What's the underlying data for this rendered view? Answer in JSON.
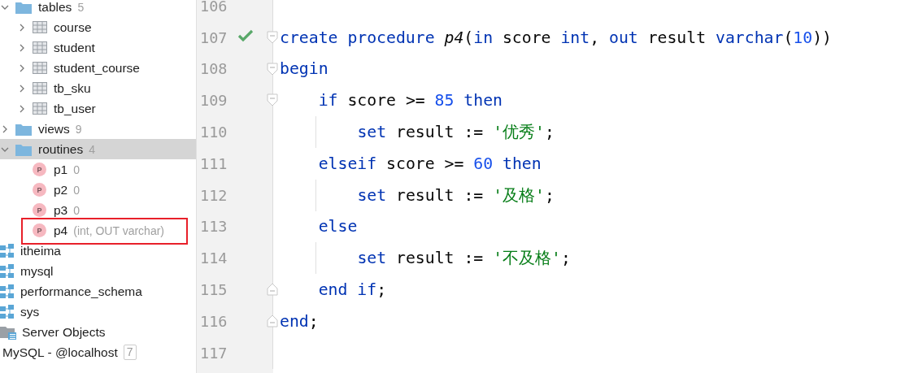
{
  "tree": {
    "objects": [
      {
        "label": "tables",
        "count": "5",
        "kind": "folder",
        "expanded": true,
        "selected": false,
        "children": [
          {
            "label": "course",
            "kind": "table",
            "expanded": false
          },
          {
            "label": "student",
            "kind": "table",
            "expanded": false
          },
          {
            "label": "student_course",
            "kind": "table",
            "expanded": false
          },
          {
            "label": "tb_sku",
            "kind": "table",
            "expanded": false
          },
          {
            "label": "tb_user",
            "kind": "table",
            "expanded": false
          }
        ]
      },
      {
        "label": "views",
        "count": "9",
        "kind": "folder",
        "expanded": false,
        "selected": false
      },
      {
        "label": "routines",
        "count": "4",
        "kind": "folder",
        "expanded": true,
        "selected": true,
        "children": [
          {
            "label": "p1",
            "detail": "0",
            "kind": "procedure",
            "badge": "P",
            "marked": false
          },
          {
            "label": "p2",
            "detail": "0",
            "kind": "procedure",
            "badge": "P",
            "marked": false
          },
          {
            "label": "p3",
            "detail": "0",
            "kind": "procedure",
            "badge": "P",
            "marked": false
          },
          {
            "label": "p4",
            "detail": "(int, OUT varchar)",
            "kind": "procedure",
            "badge": "P",
            "marked": true
          }
        ]
      }
    ],
    "schemas": [
      {
        "label": "itheima"
      },
      {
        "label": "mysql"
      },
      {
        "label": "performance_schema"
      },
      {
        "label": "sys"
      }
    ],
    "server_objects": {
      "label": "Server Objects"
    },
    "connection": {
      "label": "MySQL - @localhost",
      "count": "7"
    }
  },
  "editor": {
    "lines": [
      {
        "number": "106",
        "fold_start": false,
        "fold_end": false,
        "check": false
      },
      {
        "number": "107",
        "fold_start": true,
        "fold_end": false,
        "check": true,
        "tokens": [
          {
            "kind": "keyword",
            "text": "create "
          },
          {
            "kind": "keyword",
            "text": "procedure "
          },
          {
            "kind": "name",
            "text": "p4"
          },
          {
            "kind": "plain",
            "text": "("
          },
          {
            "kind": "keyword",
            "text": "in"
          },
          {
            "kind": "plain",
            "text": " score "
          },
          {
            "kind": "keyword",
            "text": "int"
          },
          {
            "kind": "plain",
            "text": ", "
          },
          {
            "kind": "keyword",
            "text": "out"
          },
          {
            "kind": "plain",
            "text": " result "
          },
          {
            "kind": "keyword",
            "text": "varchar"
          },
          {
            "kind": "plain",
            "text": "("
          },
          {
            "kind": "number",
            "text": "10"
          },
          {
            "kind": "plain",
            "text": "))"
          }
        ]
      },
      {
        "number": "108",
        "fold_start": true,
        "fold_end": false,
        "check": false,
        "tokens": [
          {
            "kind": "keyword",
            "text": "begin"
          }
        ],
        "children": [
          {
            "number": "109",
            "fold_start": true,
            "fold_end": false,
            "check": false,
            "tokens": [
              {
                "kind": "keyword",
                "text": "if"
              },
              {
                "kind": "plain",
                "text": " score >= "
              },
              {
                "kind": "number",
                "text": "85"
              },
              {
                "kind": "keyword",
                "text": " then"
              }
            ],
            "children": [
              {
                "number": "110",
                "fold_start": false,
                "fold_end": false,
                "check": false,
                "tokens": [
                  {
                    "kind": "keyword",
                    "text": "set"
                  },
                  {
                    "kind": "plain",
                    "text": " result := "
                  },
                  {
                    "kind": "string",
                    "text": "'优秀'"
                  },
                  {
                    "kind": "plain",
                    "text": ";"
                  }
                ]
              }
            ]
          },
          {
            "number": "111",
            "fold_start": false,
            "fold_end": false,
            "check": false,
            "tokens": [
              {
                "kind": "keyword",
                "text": "elseif"
              },
              {
                "kind": "plain",
                "text": " score >= "
              },
              {
                "kind": "number",
                "text": "60"
              },
              {
                "kind": "keyword",
                "text": " then"
              }
            ],
            "children": [
              {
                "number": "112",
                "fold_start": false,
                "fold_end": false,
                "check": false,
                "tokens": [
                  {
                    "kind": "keyword",
                    "text": "set"
                  },
                  {
                    "kind": "plain",
                    "text": " result := "
                  },
                  {
                    "kind": "string",
                    "text": "'及格'"
                  },
                  {
                    "kind": "plain",
                    "text": ";"
                  }
                ]
              }
            ]
          },
          {
            "number": "113",
            "fold_start": false,
            "fold_end": false,
            "check": false,
            "tokens": [
              {
                "kind": "keyword",
                "text": "else"
              }
            ],
            "children": [
              {
                "number": "114",
                "fold_start": false,
                "fold_end": false,
                "check": false,
                "tokens": [
                  {
                    "kind": "keyword",
                    "text": "set"
                  },
                  {
                    "kind": "plain",
                    "text": " result := "
                  },
                  {
                    "kind": "string",
                    "text": "'不及格'"
                  },
                  {
                    "kind": "plain",
                    "text": ";"
                  }
                ]
              }
            ]
          },
          {
            "number": "115",
            "fold_start": false,
            "fold_end": true,
            "check": false,
            "tokens": [
              {
                "kind": "keyword",
                "text": "end if"
              },
              {
                "kind": "plain",
                "text": ";"
              }
            ]
          }
        ]
      },
      {
        "number": "116",
        "fold_start": false,
        "fold_end": true,
        "check": false,
        "tokens": [
          {
            "kind": "keyword",
            "text": "end"
          },
          {
            "kind": "plain",
            "text": ";"
          }
        ]
      },
      {
        "number": "117",
        "fold_start": false,
        "fold_end": false,
        "check": false
      }
    ]
  }
}
